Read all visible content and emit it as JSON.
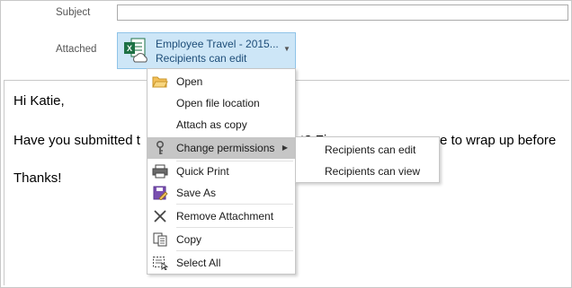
{
  "header": {
    "subject_label": "Subject",
    "subject_value": "",
    "attached_label": "Attached"
  },
  "attachment": {
    "icon": "excel-cloud-icon",
    "name": "Employee Travel - 2015...",
    "permission": "Recipients can edit"
  },
  "message": {
    "lines": [
      "Hi Katie,",
      "Have you submitted t",
      "t? Fi",
      "e to wrap up before",
      "Thanks!"
    ]
  },
  "context_menu": {
    "items": [
      {
        "label": "Open",
        "icon": "folder-open-icon"
      },
      {
        "label": "Open file location",
        "icon": ""
      },
      {
        "label": "Attach as copy",
        "icon": ""
      },
      {
        "label": "Change permissions",
        "icon": "key-icon",
        "highlighted": true,
        "has_submenu": true
      },
      {
        "label": "Quick Print",
        "icon": "printer-icon"
      },
      {
        "label": "Save As",
        "icon": "save-as-icon"
      },
      {
        "label": "Remove Attachment",
        "icon": "x-icon"
      },
      {
        "label": "Copy",
        "icon": "copy-icon"
      },
      {
        "label": "Select All",
        "icon": "select-all-icon"
      }
    ]
  },
  "submenu": {
    "items": [
      {
        "label": "Recipients can edit"
      },
      {
        "label": "Recipients can view"
      }
    ]
  },
  "colors": {
    "attachment_bg": "#cde6f7",
    "attachment_text": "#1e4e79",
    "menu_highlight": "#c6c6c6",
    "excel_green": "#1e7145"
  }
}
